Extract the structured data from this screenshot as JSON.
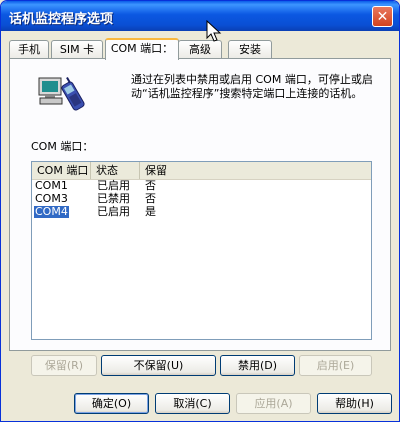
{
  "window": {
    "title": "话机监控程序选项",
    "close_glyph": "✕"
  },
  "tabs": [
    {
      "label": "手机",
      "active": false
    },
    {
      "label": "SIM 卡",
      "active": false
    },
    {
      "label": "COM 端口：",
      "active": true
    },
    {
      "label": "高级",
      "active": false
    },
    {
      "label": "安装",
      "active": false
    }
  ],
  "description": "通过在列表中禁用或启用 COM 端口，可停止或启动“话机监控程序”搜索特定端口上连接的话机。",
  "port_section_label": "COM 端口：",
  "list": {
    "columns": [
      "COM 端口",
      "状态",
      "保留"
    ],
    "rows": [
      {
        "port": "COM1",
        "status": "已启用",
        "reserved": "否",
        "selected": false
      },
      {
        "port": "COM3",
        "status": "已禁用",
        "reserved": "否",
        "selected": false
      },
      {
        "port": "COM4",
        "status": "已启用",
        "reserved": "是",
        "selected": true
      }
    ]
  },
  "port_buttons": {
    "reserve": {
      "label": "保留(R)",
      "enabled": false
    },
    "unreserve": {
      "label": "不保留(U)",
      "enabled": true
    },
    "disable": {
      "label": "禁用(D)",
      "enabled": true
    },
    "enable": {
      "label": "启用(E)",
      "enabled": false
    }
  },
  "dialog_buttons": {
    "ok": {
      "label": "确定(O)",
      "enabled": true
    },
    "cancel": {
      "label": "取消(C)",
      "enabled": true
    },
    "apply": {
      "label": "应用(A)",
      "enabled": false
    },
    "help": {
      "label": "帮助(H)",
      "enabled": true
    }
  },
  "colors": {
    "titlebar": "#0a5ce8",
    "selection": "#316ac5",
    "active_tab_accent": "#f9b840",
    "close_button": "#d2431e"
  }
}
